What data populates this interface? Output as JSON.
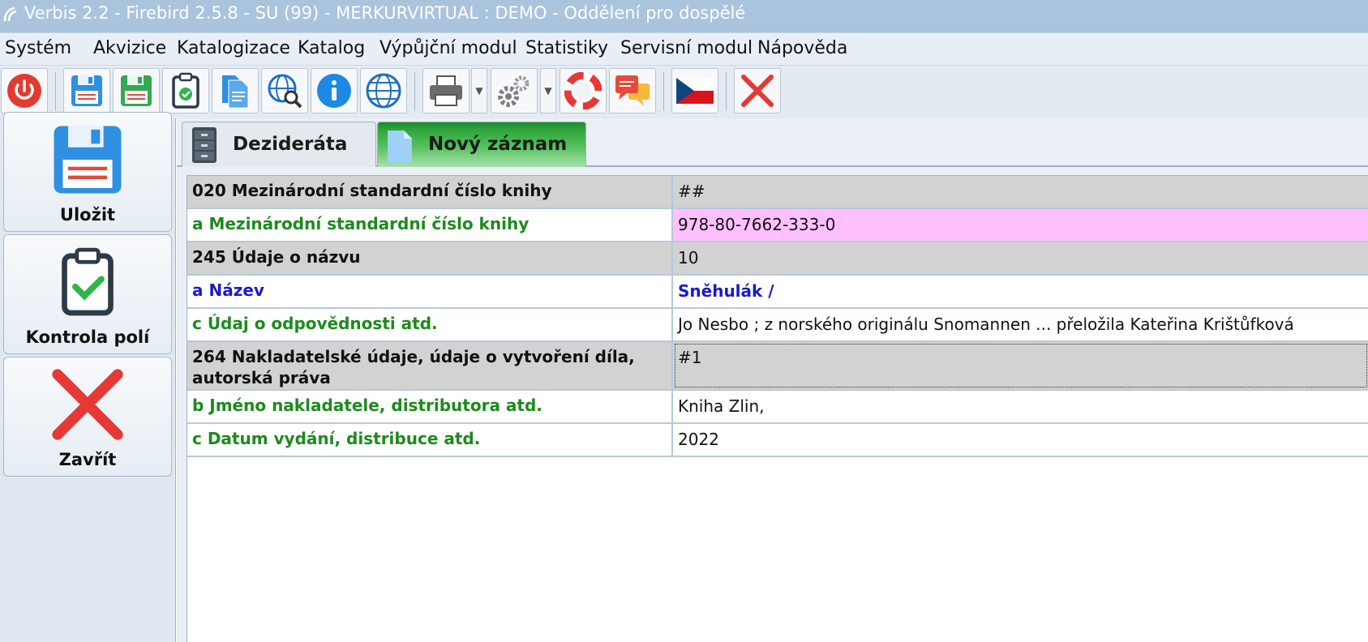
{
  "window": {
    "title": "Verbis 2.2 - Firebird 2.5.8 - SU (99) - MERKURVIRTUAL : DEMO - Oddělení pro dospělé"
  },
  "menu": [
    {
      "label": "Systém"
    },
    {
      "label": "Akvizice"
    },
    {
      "label": "Katalogizace"
    },
    {
      "label": "Katalog"
    },
    {
      "label": "Výpůjční modul"
    },
    {
      "label": "Statistiky"
    },
    {
      "label": "Servisní modul"
    },
    {
      "label": "Nápověda"
    }
  ],
  "toolbar": {
    "buttons": [
      {
        "icon": "power-icon"
      },
      {
        "icon": "save-icon"
      },
      {
        "icon": "save-green-icon"
      },
      {
        "icon": "clipboard-check-icon"
      },
      {
        "icon": "documents-icon"
      },
      {
        "icon": "globe-search-icon"
      },
      {
        "icon": "info-icon"
      },
      {
        "icon": "globe-icon"
      },
      {
        "icon": "printer-icon"
      },
      {
        "icon": "gears-icon"
      },
      {
        "icon": "lifebuoy-icon"
      },
      {
        "icon": "chat-icon"
      },
      {
        "icon": "czech-flag-icon"
      },
      {
        "icon": "close-icon"
      }
    ]
  },
  "sidebar": {
    "save_label": "Uložit",
    "check_label": "Kontrola polí",
    "close_label": "Zavřít"
  },
  "tabs": [
    {
      "label": "Dezideráta",
      "active": false
    },
    {
      "label": "Nový záznam",
      "active": true
    }
  ],
  "record": {
    "rows": [
      {
        "kind": "field",
        "label": "020 Mezinárodní standardní číslo knihy",
        "value": "##"
      },
      {
        "kind": "sub",
        "label": "a Mezinárodní standardní číslo knihy",
        "value": "978-80-7662-333-0",
        "highlight": "#ffc0ff"
      },
      {
        "kind": "field",
        "label": "245 Údaje o názvu",
        "value": "10"
      },
      {
        "kind": "title",
        "label": "a Název",
        "value": "Sněhulák /"
      },
      {
        "kind": "sub",
        "label": "c Údaj o odpovědnosti atd.",
        "value": "Jo Nesbo ; z norského originálu Snomannen ... přeložila Kateřina Krištůfková"
      },
      {
        "kind": "field",
        "label": "264 Nakladatelské údaje, údaje o vytvoření díla, autorská práva",
        "value": "#1"
      },
      {
        "kind": "sub",
        "label": "b Jméno nakladatele, distributora atd.",
        "value": "Kniha Zlin,"
      },
      {
        "kind": "sub",
        "label": "c Datum vydání, distribuce atd.",
        "value": "2022"
      }
    ]
  },
  "colors": {
    "field_label": "#111111",
    "subfield_label": "#1d8a1d",
    "title_subfield": "#1a1acc",
    "field_row_bg": "#d2d2d2",
    "active_tab": "#2ea43a"
  }
}
